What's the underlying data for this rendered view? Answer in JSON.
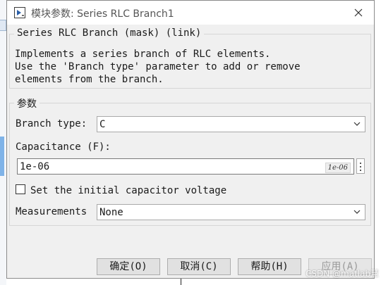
{
  "window": {
    "title": "模块参数: Series RLC Branch1",
    "close_icon": "close-icon"
  },
  "description": {
    "group_title": "Series RLC Branch (mask) (link)",
    "text": "Implements a series branch of RLC elements.\nUse the 'Branch type' parameter to add or remove\nelements from the branch."
  },
  "parameters": {
    "group_title": "参数",
    "branch_type_label": "Branch type:",
    "branch_type_value": "C",
    "capacitance_label": "Capacitance (F):",
    "capacitance_value": "1e-06",
    "capacitance_hint": "1e-06",
    "initial_voltage_label": "Set the initial capacitor voltage",
    "initial_voltage_checked": false,
    "measurements_label": "Measurements",
    "measurements_value": "None"
  },
  "buttons": {
    "ok": "确定(O)",
    "cancel": "取消(C)",
    "help": "帮助(H)",
    "apply": "应用(A)"
  },
  "watermark": "CSDN @matlab慧",
  "colors": {
    "dialog_bg": "#f0f0f0",
    "selection_accent": "#7fb3e8"
  }
}
